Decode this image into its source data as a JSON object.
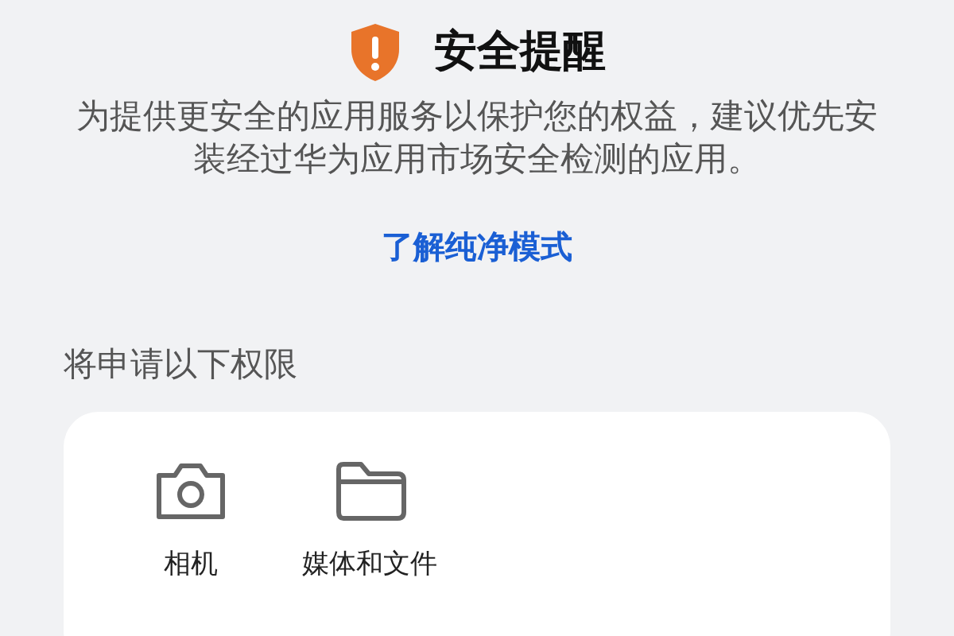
{
  "header": {
    "title": "安全提醒"
  },
  "message": "为提供更安全的应用服务以保护您的权益，建议优先安装经过华为应用市场安全检测的应用。",
  "link": "了解纯净模式",
  "permissions": {
    "heading": "将申请以下权限",
    "items": [
      {
        "kind": "camera",
        "label": "相机"
      },
      {
        "kind": "folder",
        "label": "媒体和文件"
      }
    ]
  }
}
